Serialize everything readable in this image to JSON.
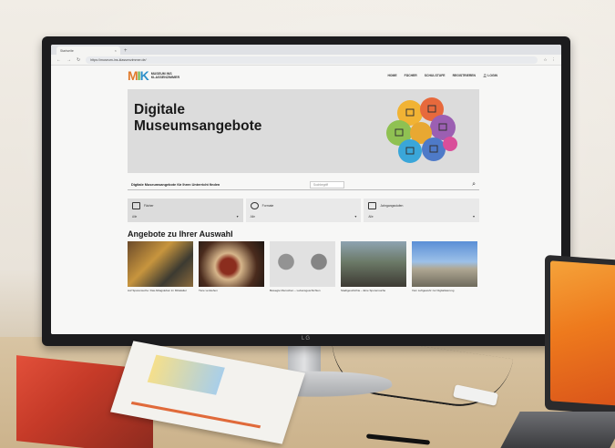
{
  "browser": {
    "tab_title": "Startseite",
    "url": "https://museum-ins-klassenzimmer.de/"
  },
  "site": {
    "logo_text_line1": "MUSEUM INS",
    "logo_text_line2": "KLASSENZIMMER",
    "nav": [
      "HOME",
      "FÄCHER",
      "SCHULSTUFE",
      "REGISTRIEREN",
      "LOGIN"
    ],
    "hero_title_line1": "Digitale",
    "hero_title_line2": "Museumsangebote",
    "search_lead": "Digitale Museumsangebote für Ihren Unterricht finden",
    "search_placeholder": "Suchbegriff",
    "filters": [
      {
        "label": "Fächer",
        "value": "Alle"
      },
      {
        "label": "Formate",
        "value": "Alle"
      },
      {
        "label": "Jahrgangsstufen",
        "value": "Alle"
      }
    ],
    "offers_title": "Angebote zu Ihrer Auswahl",
    "cards": [
      {
        "caption": "Auf Spurensuche: Das Alltagsleben im Mittelalter"
      },
      {
        "caption": "Tiere verstehen"
      },
      {
        "caption": "Bewegte Menschen – Lebensgeschichten"
      },
      {
        "caption": "Stadtgeschichte – Eine Spurensuche"
      },
      {
        "caption": "Vom Luftgewehr zur Digitalisierung"
      }
    ]
  },
  "monitor_brand": "LG"
}
